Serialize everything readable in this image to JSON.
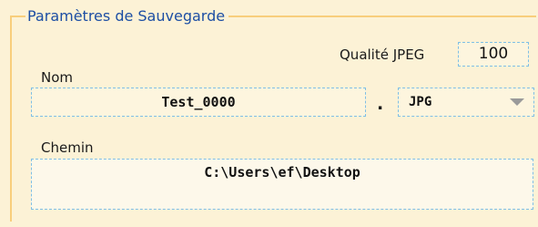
{
  "group": {
    "title": "Paramètres de Sauvegarde"
  },
  "name": {
    "label": "Nom",
    "value": "Test_0000"
  },
  "quality": {
    "label": "Qualité JPEG",
    "value": "100"
  },
  "extension": {
    "separator": ".",
    "selected": "JPG"
  },
  "path": {
    "label": "Chemin",
    "value": "C:\\Users\\ef\\Desktop"
  },
  "colors": {
    "background": "#fcf2d6",
    "group_border": "#f8ce7c",
    "title_text": "#1d4fa4",
    "field_border": "#7fbfe6"
  },
  "icons": {
    "dropdown": "chevron-down-icon"
  }
}
